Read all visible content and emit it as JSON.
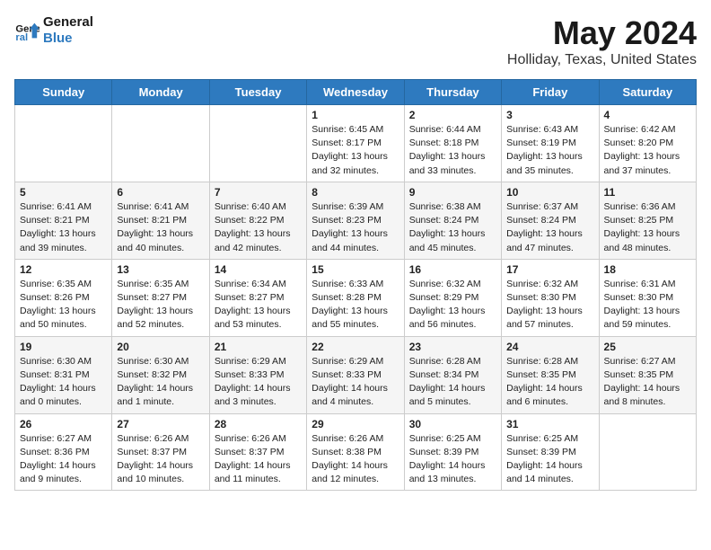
{
  "header": {
    "logo_line1": "General",
    "logo_line2": "Blue",
    "main_title": "May 2024",
    "subtitle": "Holliday, Texas, United States"
  },
  "weekdays": [
    "Sunday",
    "Monday",
    "Tuesday",
    "Wednesday",
    "Thursday",
    "Friday",
    "Saturday"
  ],
  "weeks": [
    [
      {
        "day": "",
        "info": ""
      },
      {
        "day": "",
        "info": ""
      },
      {
        "day": "",
        "info": ""
      },
      {
        "day": "1",
        "info": "Sunrise: 6:45 AM\nSunset: 8:17 PM\nDaylight: 13 hours and 32 minutes."
      },
      {
        "day": "2",
        "info": "Sunrise: 6:44 AM\nSunset: 8:18 PM\nDaylight: 13 hours and 33 minutes."
      },
      {
        "day": "3",
        "info": "Sunrise: 6:43 AM\nSunset: 8:19 PM\nDaylight: 13 hours and 35 minutes."
      },
      {
        "day": "4",
        "info": "Sunrise: 6:42 AM\nSunset: 8:20 PM\nDaylight: 13 hours and 37 minutes."
      }
    ],
    [
      {
        "day": "5",
        "info": "Sunrise: 6:41 AM\nSunset: 8:21 PM\nDaylight: 13 hours and 39 minutes."
      },
      {
        "day": "6",
        "info": "Sunrise: 6:41 AM\nSunset: 8:21 PM\nDaylight: 13 hours and 40 minutes."
      },
      {
        "day": "7",
        "info": "Sunrise: 6:40 AM\nSunset: 8:22 PM\nDaylight: 13 hours and 42 minutes."
      },
      {
        "day": "8",
        "info": "Sunrise: 6:39 AM\nSunset: 8:23 PM\nDaylight: 13 hours and 44 minutes."
      },
      {
        "day": "9",
        "info": "Sunrise: 6:38 AM\nSunset: 8:24 PM\nDaylight: 13 hours and 45 minutes."
      },
      {
        "day": "10",
        "info": "Sunrise: 6:37 AM\nSunset: 8:24 PM\nDaylight: 13 hours and 47 minutes."
      },
      {
        "day": "11",
        "info": "Sunrise: 6:36 AM\nSunset: 8:25 PM\nDaylight: 13 hours and 48 minutes."
      }
    ],
    [
      {
        "day": "12",
        "info": "Sunrise: 6:35 AM\nSunset: 8:26 PM\nDaylight: 13 hours and 50 minutes."
      },
      {
        "day": "13",
        "info": "Sunrise: 6:35 AM\nSunset: 8:27 PM\nDaylight: 13 hours and 52 minutes."
      },
      {
        "day": "14",
        "info": "Sunrise: 6:34 AM\nSunset: 8:27 PM\nDaylight: 13 hours and 53 minutes."
      },
      {
        "day": "15",
        "info": "Sunrise: 6:33 AM\nSunset: 8:28 PM\nDaylight: 13 hours and 55 minutes."
      },
      {
        "day": "16",
        "info": "Sunrise: 6:32 AM\nSunset: 8:29 PM\nDaylight: 13 hours and 56 minutes."
      },
      {
        "day": "17",
        "info": "Sunrise: 6:32 AM\nSunset: 8:30 PM\nDaylight: 13 hours and 57 minutes."
      },
      {
        "day": "18",
        "info": "Sunrise: 6:31 AM\nSunset: 8:30 PM\nDaylight: 13 hours and 59 minutes."
      }
    ],
    [
      {
        "day": "19",
        "info": "Sunrise: 6:30 AM\nSunset: 8:31 PM\nDaylight: 14 hours and 0 minutes."
      },
      {
        "day": "20",
        "info": "Sunrise: 6:30 AM\nSunset: 8:32 PM\nDaylight: 14 hours and 1 minute."
      },
      {
        "day": "21",
        "info": "Sunrise: 6:29 AM\nSunset: 8:33 PM\nDaylight: 14 hours and 3 minutes."
      },
      {
        "day": "22",
        "info": "Sunrise: 6:29 AM\nSunset: 8:33 PM\nDaylight: 14 hours and 4 minutes."
      },
      {
        "day": "23",
        "info": "Sunrise: 6:28 AM\nSunset: 8:34 PM\nDaylight: 14 hours and 5 minutes."
      },
      {
        "day": "24",
        "info": "Sunrise: 6:28 AM\nSunset: 8:35 PM\nDaylight: 14 hours and 6 minutes."
      },
      {
        "day": "25",
        "info": "Sunrise: 6:27 AM\nSunset: 8:35 PM\nDaylight: 14 hours and 8 minutes."
      }
    ],
    [
      {
        "day": "26",
        "info": "Sunrise: 6:27 AM\nSunset: 8:36 PM\nDaylight: 14 hours and 9 minutes."
      },
      {
        "day": "27",
        "info": "Sunrise: 6:26 AM\nSunset: 8:37 PM\nDaylight: 14 hours and 10 minutes."
      },
      {
        "day": "28",
        "info": "Sunrise: 6:26 AM\nSunset: 8:37 PM\nDaylight: 14 hours and 11 minutes."
      },
      {
        "day": "29",
        "info": "Sunrise: 6:26 AM\nSunset: 8:38 PM\nDaylight: 14 hours and 12 minutes."
      },
      {
        "day": "30",
        "info": "Sunrise: 6:25 AM\nSunset: 8:39 PM\nDaylight: 14 hours and 13 minutes."
      },
      {
        "day": "31",
        "info": "Sunrise: 6:25 AM\nSunset: 8:39 PM\nDaylight: 14 hours and 14 minutes."
      },
      {
        "day": "",
        "info": ""
      }
    ]
  ]
}
